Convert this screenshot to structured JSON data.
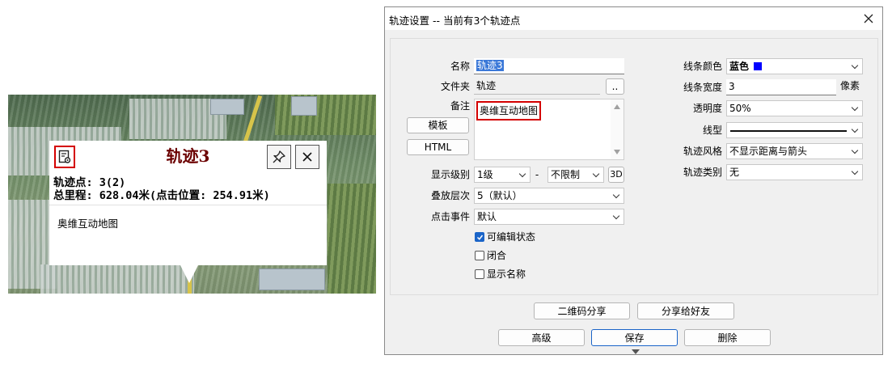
{
  "popup": {
    "title": "轨迹3",
    "points_line": "轨迹点: 3(2)",
    "distance_line": "总里程: 628.04米(点击位置: 254.91米)",
    "note": "奥维互动地图"
  },
  "dialog": {
    "title": "轨迹设置 -- 当前有3个轨迹点",
    "name_label": "名称",
    "name_value": "轨迹3",
    "folder_label": "文件夹",
    "folder_value": "轨迹",
    "folder_browse": "..",
    "note_label": "备注",
    "note_value": "奥维互动地图",
    "template_button": "模板",
    "html_button": "HTML",
    "display_level_label": "显示级别",
    "display_level_value": "1级",
    "display_level_sep": "-",
    "display_level_max": "不限制",
    "button_3d": "3D",
    "layer_label": "叠放层次",
    "layer_value": "5（默认）",
    "click_event_label": "点击事件",
    "click_event_value": "默认",
    "checkbox_editable": "可编辑状态",
    "checkbox_closed": "闭合",
    "checkbox_show_name": "显示名称",
    "line_color_label": "线条颜色",
    "line_color_value": "蓝色",
    "line_color_hex": "#0000ff",
    "line_width_label": "线条宽度",
    "line_width_value": "3",
    "line_width_unit": "像素",
    "opacity_label": "透明度",
    "opacity_value": "50%",
    "line_type_label": "线型",
    "track_style_label": "轨迹风格",
    "track_style_value": "不显示距离与箭头",
    "track_category_label": "轨迹类别",
    "track_category_value": "无",
    "qr_share_button": "二维码分享",
    "share_friend_button": "分享给好友",
    "advanced_button": "高级",
    "save_button": "保存",
    "delete_button": "删除"
  },
  "colors": {
    "popup_title": "#6b0000",
    "highlight_border": "#d40000",
    "checkbox_checked": "#1a64c8",
    "primary_button_border": "#1a64c8"
  }
}
